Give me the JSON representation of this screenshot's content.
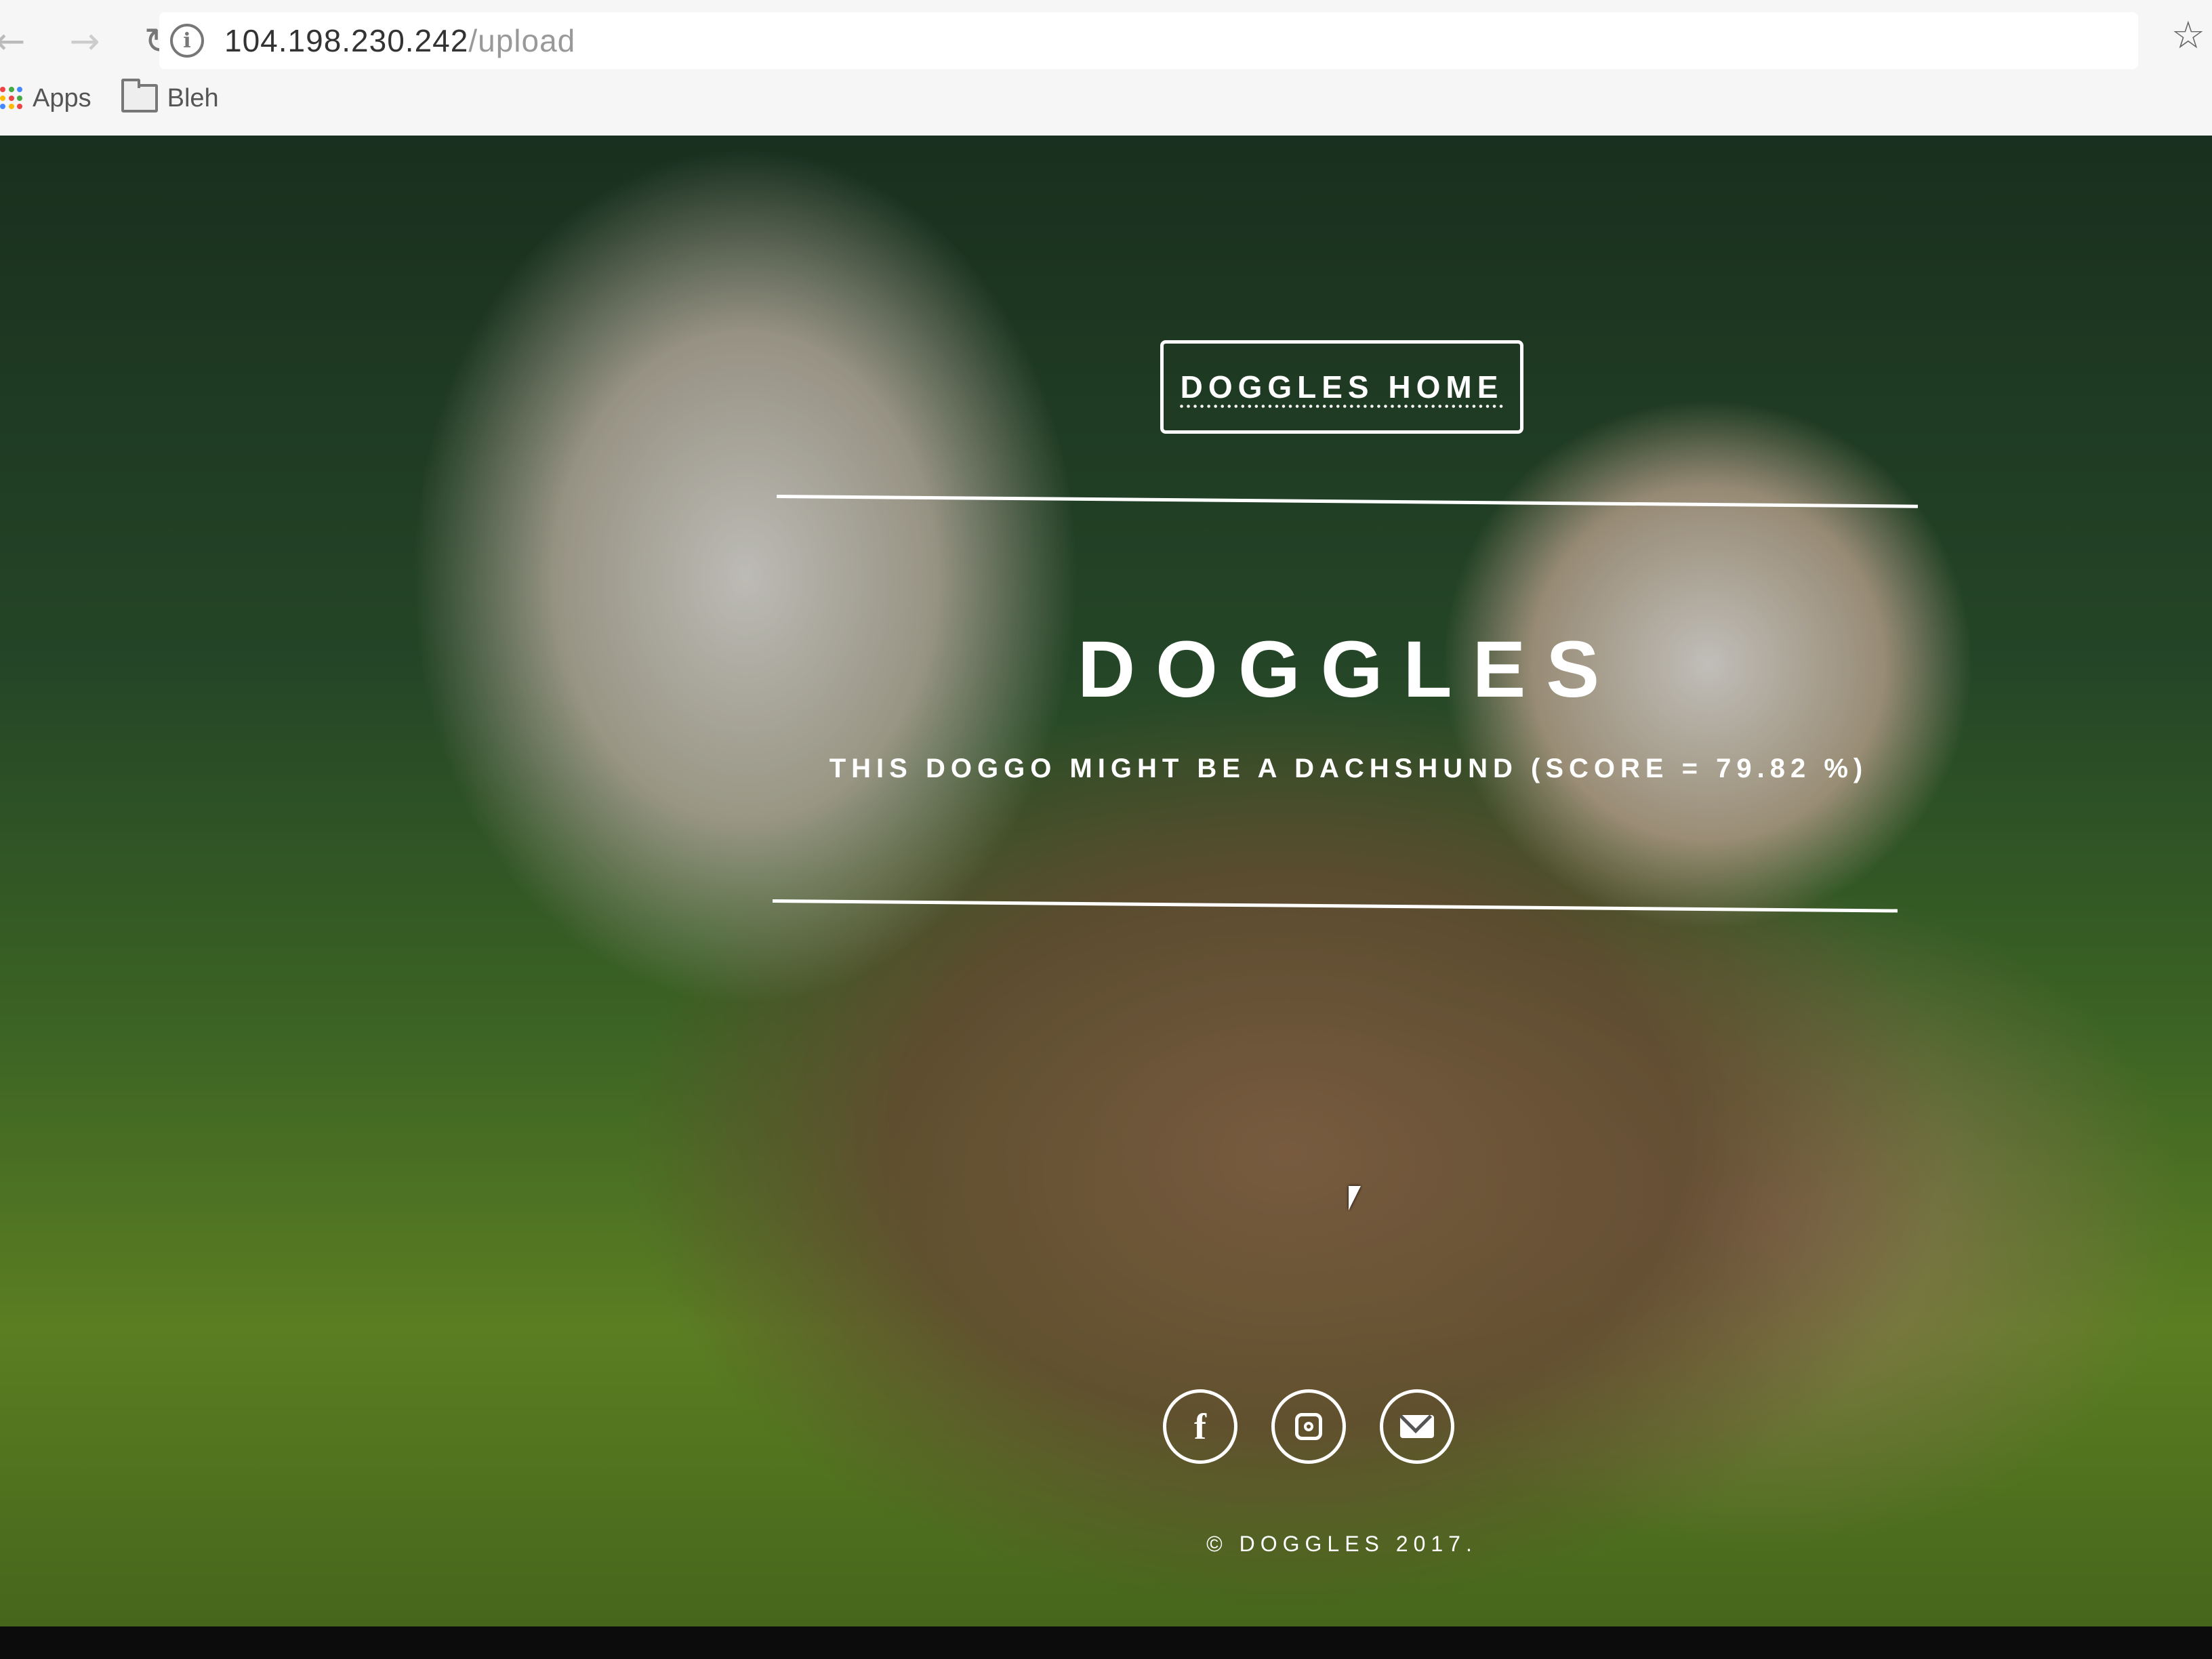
{
  "browser": {
    "url_host": "104.198.230.242",
    "url_path": "/upload",
    "bookmarks": [
      {
        "label": "Apps",
        "icon": "apps-grid-icon"
      },
      {
        "label": "Bleh",
        "icon": "folder-icon"
      }
    ]
  },
  "page": {
    "home_button_label": "DOGGLES HOME",
    "title": "DOGGLES",
    "result": "THIS DOGGO MIGHT BE A DACHSHUND (SCORE = 79.82 %)",
    "social_links": [
      {
        "name": "facebook",
        "icon": "facebook-icon"
      },
      {
        "name": "instagram",
        "icon": "instagram-icon"
      },
      {
        "name": "email",
        "icon": "email-icon"
      }
    ],
    "copyright": "© DOGGLES 2017."
  },
  "colors": {
    "text": "#ffffff",
    "grass": "#6f9a2a",
    "foliage": "#2d5530"
  }
}
